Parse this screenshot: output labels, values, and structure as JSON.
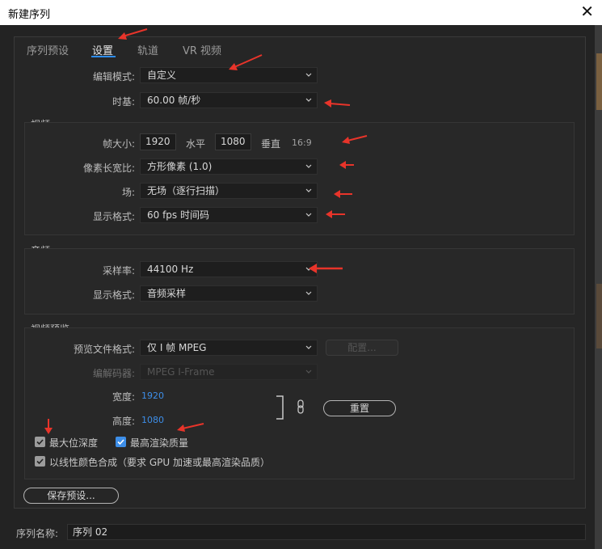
{
  "window": {
    "title": "新建序列",
    "close_glyph": "✕"
  },
  "tabs": [
    {
      "label": "序列预设"
    },
    {
      "label": "设置"
    },
    {
      "label": "轨道"
    },
    {
      "label": "VR 视频"
    }
  ],
  "settings": {
    "edit_mode": {
      "label": "编辑模式:",
      "value": "自定义"
    },
    "timebase": {
      "label": "时基:",
      "value": "60.00  帧/秒"
    }
  },
  "video": {
    "title": "视频",
    "frame_size": {
      "label": "帧大小:",
      "width": "1920",
      "width_unit": "水平",
      "height": "1080",
      "height_unit": "垂直",
      "ratio": "16:9"
    },
    "pixel_aspect": {
      "label": "像素长宽比:",
      "value": "方形像素 (1.0)"
    },
    "fields": {
      "label": "场:",
      "value": "无场（逐行扫描）"
    },
    "display_format": {
      "label": "显示格式:",
      "value": "60 fps 时间码"
    }
  },
  "audio": {
    "title": "音频",
    "sample_rate": {
      "label": "采样率:",
      "value": "44100 Hz"
    },
    "display_format": {
      "label": "显示格式:",
      "value": "音频采样"
    }
  },
  "preview": {
    "title": "视频预览",
    "file_format": {
      "label": "预览文件格式:",
      "value": "仅 I 帧 MPEG"
    },
    "configure_button": "配置...",
    "codec": {
      "label": "编解码器:",
      "value": "MPEG I-Frame"
    },
    "width": {
      "label": "宽度:",
      "value": "1920"
    },
    "height": {
      "label": "高度:",
      "value": "1080"
    },
    "reset_button": "重置",
    "max_bit_depth": {
      "label": "最大位深度",
      "checked": true
    },
    "max_render_quality": {
      "label": "最高渲染质量",
      "checked": true
    },
    "linear_color": {
      "label": "以线性颜色合成（要求 GPU 加速或最高渲染品质）",
      "checked": true
    }
  },
  "save_preset_button": "保存预设...",
  "sequence_name": {
    "label": "序列名称:",
    "value": "序列 02"
  },
  "colors": {
    "accent": "#3d8ee8",
    "annotation_arrow": "#e8342a"
  }
}
